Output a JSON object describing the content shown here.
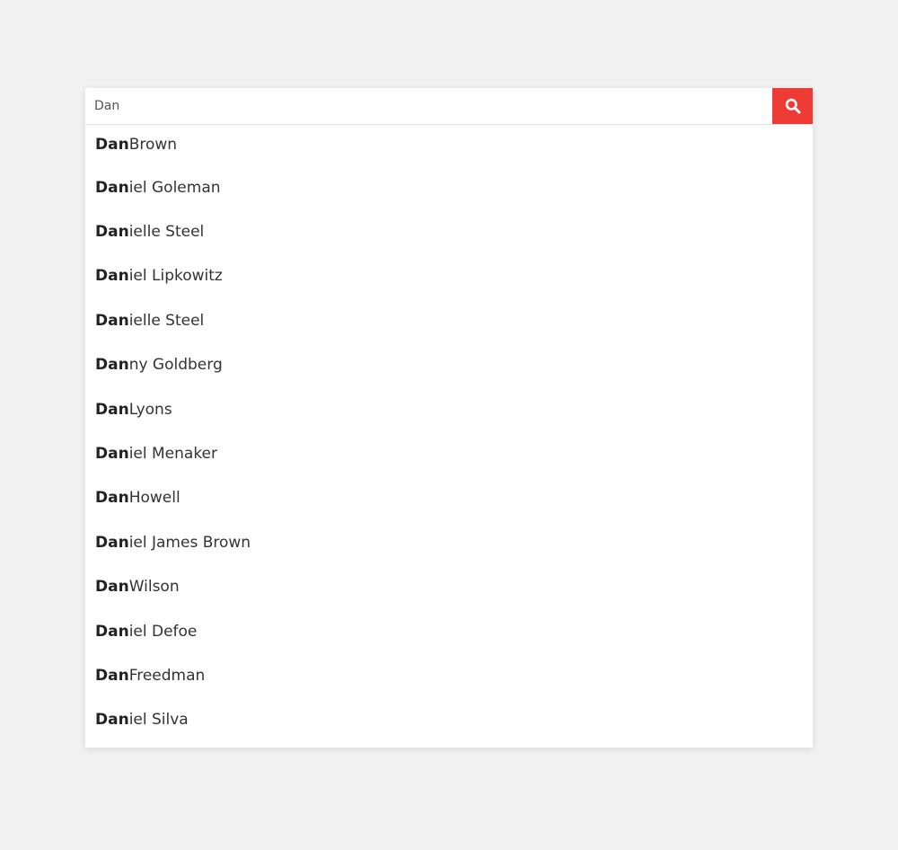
{
  "colors": {
    "page_background": "#f1f1f1",
    "search_button": "#ef3b36",
    "text": "#333333"
  },
  "search": {
    "value": "Dan",
    "button_icon": "search-icon"
  },
  "suggestions": [
    {
      "match": "Dan",
      "rest": " Brown"
    },
    {
      "match": "Dan",
      "rest": "iel Goleman"
    },
    {
      "match": "Dan",
      "rest": "ielle Steel"
    },
    {
      "match": "Dan",
      "rest": "iel Lipkowitz"
    },
    {
      "match": "Dan",
      "rest": "ielle Steel"
    },
    {
      "match": "Dan",
      "rest": "ny Goldberg"
    },
    {
      "match": "Dan",
      "rest": " Lyons"
    },
    {
      "match": "Dan",
      "rest": "iel Menaker"
    },
    {
      "match": "Dan",
      "rest": " Howell"
    },
    {
      "match": "Dan",
      "rest": "iel James Brown"
    },
    {
      "match": "Dan",
      "rest": " Wilson"
    },
    {
      "match": "Dan",
      "rest": "iel Defoe"
    },
    {
      "match": "Dan",
      "rest": " Freedman"
    },
    {
      "match": "Dan",
      "rest": "iel Silva"
    }
  ]
}
